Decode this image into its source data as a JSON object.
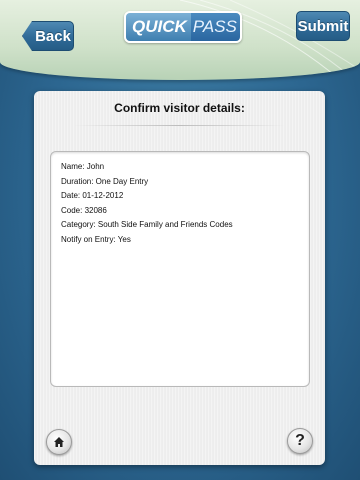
{
  "header": {
    "back_label": "Back",
    "submit_label": "Submit",
    "logo": {
      "quick": "QUICK",
      "pass": "PASS",
      "registered": "®"
    }
  },
  "card": {
    "title": "Confirm visitor details:",
    "details": [
      "Name: John",
      "Duration: One Day Entry",
      "Date: 01-12-2012",
      "Code: 32086",
      "Category: South Side Family and Friends Codes",
      "Notify on Entry: Yes"
    ]
  },
  "footer": {
    "help_label": "?"
  },
  "icons": {
    "home": "home-icon",
    "help": "help-icon",
    "back": "back-arrow-button"
  },
  "colors": {
    "background": "#2c6690",
    "header": "#cfe1c9",
    "button": "#2f6a97"
  }
}
